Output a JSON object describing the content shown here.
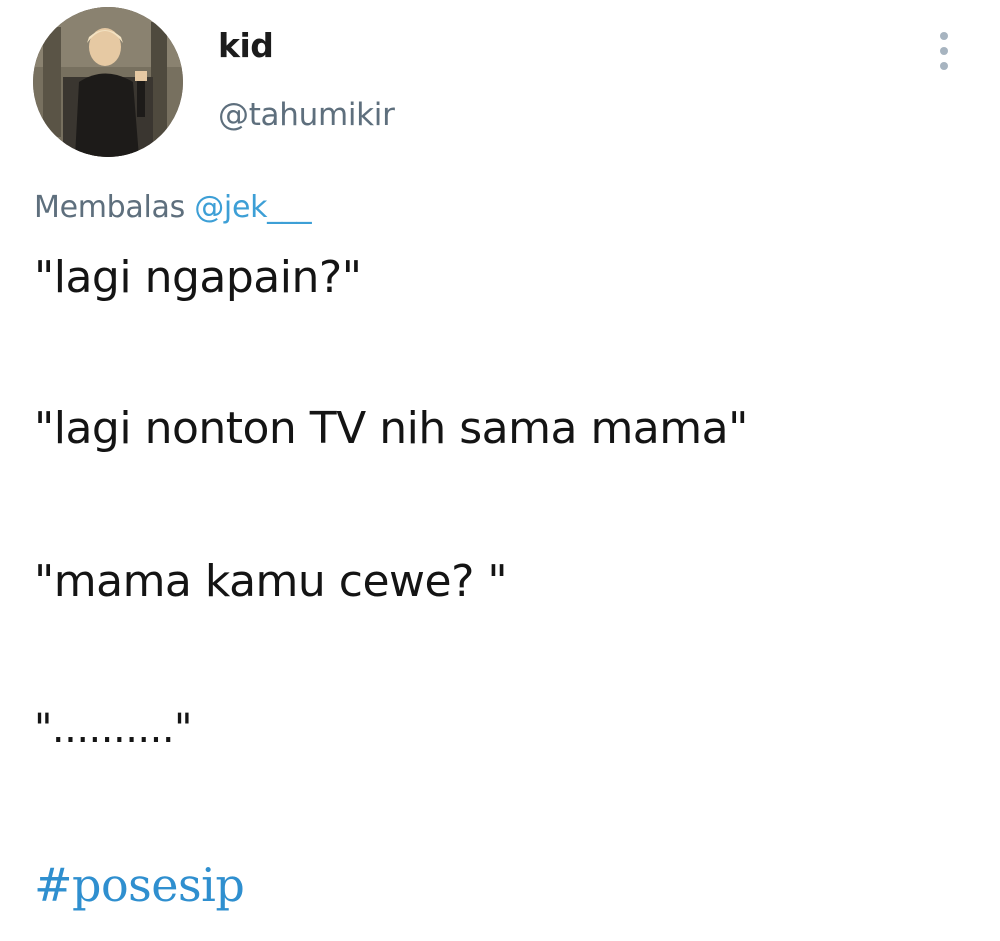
{
  "author": {
    "display_name": "kid",
    "handle": "@tahumikir",
    "avatar_icon": "profile-photo"
  },
  "reply": {
    "prefix": "Membalas",
    "mention": "@jek___"
  },
  "tweet": {
    "lines": [
      "\"lagi ngapain?\"",
      "\"lagi nonton TV nih sama mama\"",
      "\"mama kamu cewe? \"",
      "\"..........\""
    ],
    "hashtag": "#posesip"
  },
  "menu": {
    "icon": "more-vertical-icon"
  },
  "colors": {
    "accent": "#3d9fd6",
    "secondary_text": "#5e6f7d",
    "menu_dots": "#a7b4c0"
  }
}
